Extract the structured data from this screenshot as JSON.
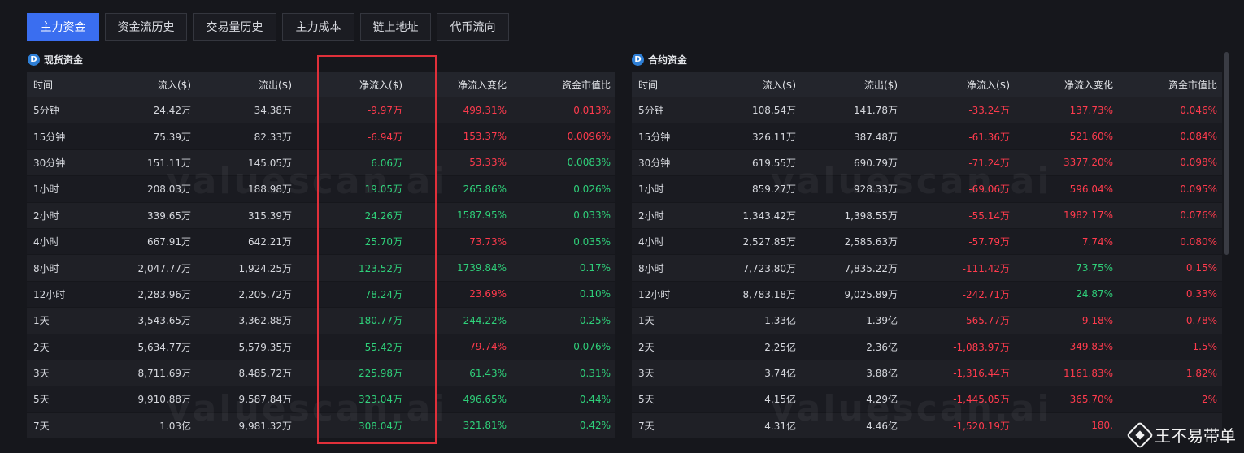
{
  "tabs": [
    "主力资金",
    "资金流历史",
    "交易量历史",
    "主力成本",
    "链上地址",
    "代币流向"
  ],
  "watermark": "valuescan.ai",
  "attribution": "王不易带单",
  "colors": {
    "positive": "#2fd07a",
    "negative": "#ff3b4d",
    "accent": "#3a6ef0",
    "highlight": "#e0303a"
  },
  "spot": {
    "title": "现货资金",
    "headers": [
      "时间",
      "流入($)",
      "流出($)",
      "净流入($)",
      "净流入变化",
      "资金市值比"
    ],
    "rows": [
      [
        "5分钟",
        "24.42万",
        "34.38万",
        "-9.97万",
        "499.31%",
        "0.013%"
      ],
      [
        "15分钟",
        "75.39万",
        "82.33万",
        "-6.94万",
        "153.37%",
        "0.0096%"
      ],
      [
        "30分钟",
        "151.11万",
        "145.05万",
        "6.06万",
        "53.33%",
        "0.0083%"
      ],
      [
        "1小时",
        "208.03万",
        "188.98万",
        "19.05万",
        "265.86%",
        "0.026%"
      ],
      [
        "2小时",
        "339.65万",
        "315.39万",
        "24.26万",
        "1587.95%",
        "0.033%"
      ],
      [
        "4小时",
        "667.91万",
        "642.21万",
        "25.70万",
        "73.73%",
        "0.035%"
      ],
      [
        "8小时",
        "2,047.77万",
        "1,924.25万",
        "123.52万",
        "1739.84%",
        "0.17%"
      ],
      [
        "12小时",
        "2,283.96万",
        "2,205.72万",
        "78.24万",
        "23.69%",
        "0.10%"
      ],
      [
        "1天",
        "3,543.65万",
        "3,362.88万",
        "180.77万",
        "244.22%",
        "0.25%"
      ],
      [
        "2天",
        "5,634.77万",
        "5,579.35万",
        "55.42万",
        "79.74%",
        "0.076%"
      ],
      [
        "3天",
        "8,711.69万",
        "8,485.72万",
        "225.98万",
        "61.43%",
        "0.31%"
      ],
      [
        "5天",
        "9,910.88万",
        "9,587.84万",
        "323.04万",
        "496.65%",
        "0.44%"
      ],
      [
        "7天",
        "1.03亿",
        "9,981.32万",
        "308.04万",
        "321.81%",
        "0.42%"
      ]
    ],
    "colors": [
      [
        "neg",
        "neg",
        "neg"
      ],
      [
        "neg",
        "neg",
        "neg"
      ],
      [
        "pos",
        "neg",
        "pos"
      ],
      [
        "pos",
        "pos",
        "pos"
      ],
      [
        "pos",
        "pos",
        "pos"
      ],
      [
        "pos",
        "neg",
        "pos"
      ],
      [
        "pos",
        "pos",
        "pos"
      ],
      [
        "pos",
        "neg",
        "pos"
      ],
      [
        "pos",
        "pos",
        "pos"
      ],
      [
        "pos",
        "neg",
        "pos"
      ],
      [
        "pos",
        "pos",
        "pos"
      ],
      [
        "pos",
        "pos",
        "pos"
      ],
      [
        "pos",
        "pos",
        "pos"
      ]
    ]
  },
  "futures": {
    "title": "合约资金",
    "headers": [
      "时间",
      "流入($)",
      "流出($)",
      "净流入($)",
      "净流入变化",
      "资金市值比"
    ],
    "rows": [
      [
        "5分钟",
        "108.54万",
        "141.78万",
        "-33.24万",
        "137.73%",
        "0.046%"
      ],
      [
        "15分钟",
        "326.11万",
        "387.48万",
        "-61.36万",
        "521.60%",
        "0.084%"
      ],
      [
        "30分钟",
        "619.55万",
        "690.79万",
        "-71.24万",
        "3377.20%",
        "0.098%"
      ],
      [
        "1小时",
        "859.27万",
        "928.33万",
        "-69.06万",
        "596.04%",
        "0.095%"
      ],
      [
        "2小时",
        "1,343.42万",
        "1,398.55万",
        "-55.14万",
        "1982.17%",
        "0.076%"
      ],
      [
        "4小时",
        "2,527.85万",
        "2,585.63万",
        "-57.79万",
        "7.74%",
        "0.080%"
      ],
      [
        "8小时",
        "7,723.80万",
        "7,835.22万",
        "-111.42万",
        "73.75%",
        "0.15%"
      ],
      [
        "12小时",
        "8,783.18万",
        "9,025.89万",
        "-242.71万",
        "24.87%",
        "0.33%"
      ],
      [
        "1天",
        "1.33亿",
        "1.39亿",
        "-565.77万",
        "9.18%",
        "0.78%"
      ],
      [
        "2天",
        "2.25亿",
        "2.36亿",
        "-1,083.97万",
        "349.83%",
        "1.5%"
      ],
      [
        "3天",
        "3.74亿",
        "3.88亿",
        "-1,316.44万",
        "1161.83%",
        "1.82%"
      ],
      [
        "5天",
        "4.15亿",
        "4.29亿",
        "-1,445.05万",
        "365.70%",
        "2%"
      ],
      [
        "7天",
        "4.31亿",
        "4.46亿",
        "-1,520.19万",
        "180.",
        ""
      ]
    ],
    "colors": [
      [
        "neg",
        "neg",
        "neg"
      ],
      [
        "neg",
        "neg",
        "neg"
      ],
      [
        "neg",
        "neg",
        "neg"
      ],
      [
        "neg",
        "neg",
        "neg"
      ],
      [
        "neg",
        "neg",
        "neg"
      ],
      [
        "neg",
        "neg",
        "neg"
      ],
      [
        "neg",
        "pos",
        "neg"
      ],
      [
        "neg",
        "pos",
        "neg"
      ],
      [
        "neg",
        "neg",
        "neg"
      ],
      [
        "neg",
        "neg",
        "neg"
      ],
      [
        "neg",
        "neg",
        "neg"
      ],
      [
        "neg",
        "neg",
        "neg"
      ],
      [
        "neg",
        "neg",
        "neg"
      ]
    ]
  }
}
